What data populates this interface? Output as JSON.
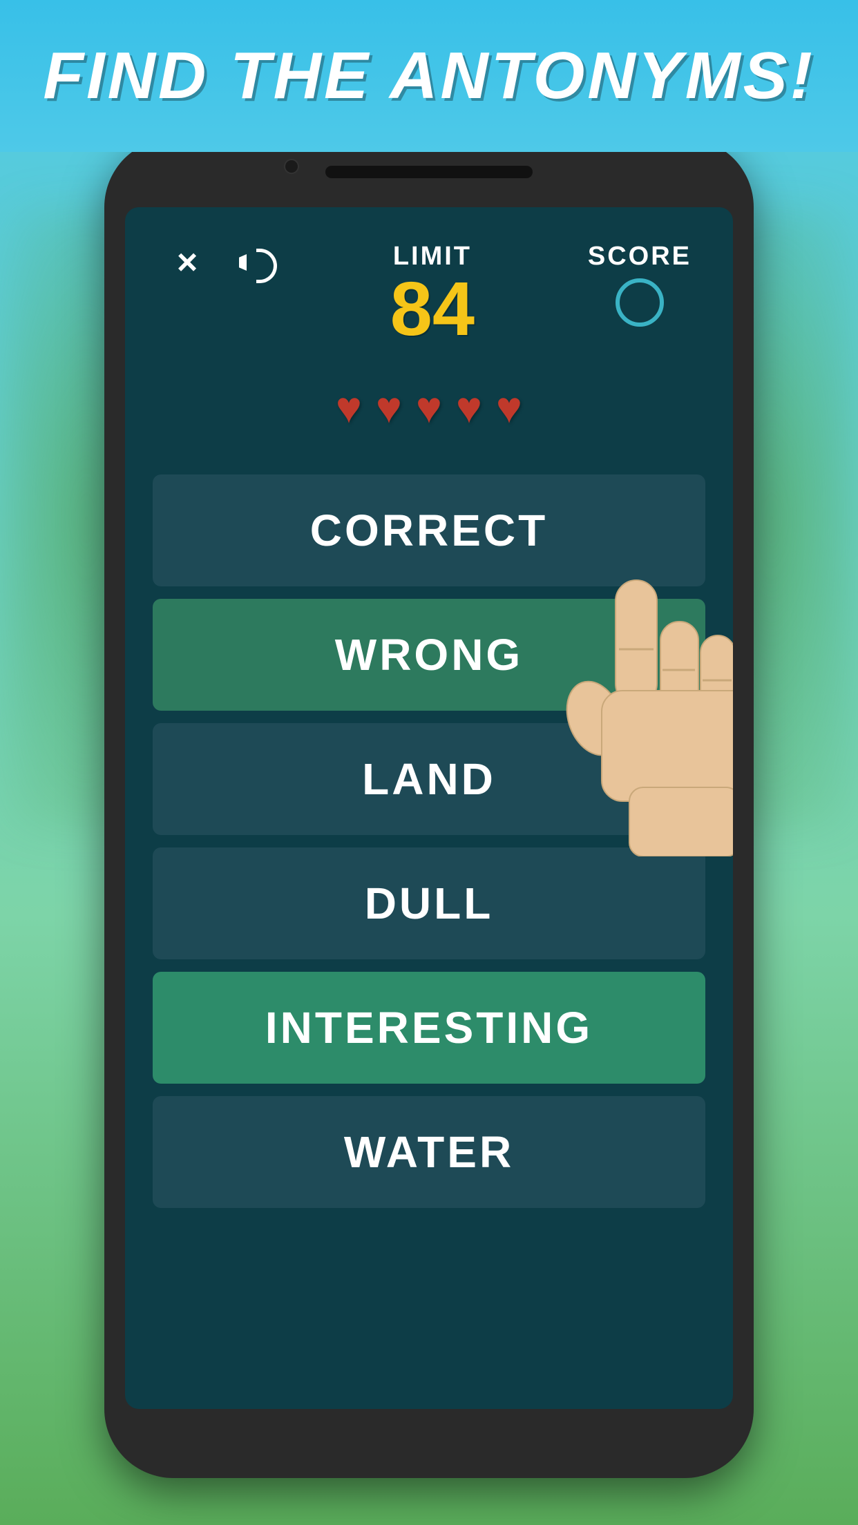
{
  "background": {
    "sky_color_top": "#38c0e8",
    "sky_color_bottom": "#4ec9e8",
    "grass_color": "#5aad5a"
  },
  "title": {
    "text": "FIND THE ANTONYMS!"
  },
  "header": {
    "close_label": "×",
    "sound_label": "sound",
    "limit_label": "LIMIT",
    "limit_value": "84",
    "score_label": "SCORE"
  },
  "lives": {
    "count": 5,
    "heart_symbol": "♥"
  },
  "answers": [
    {
      "label": "CORRECT",
      "style": "dark"
    },
    {
      "label": "WRONG",
      "style": "green"
    },
    {
      "label": "LAND",
      "style": "dark"
    },
    {
      "label": "DULL",
      "style": "dark"
    },
    {
      "label": "INTERESTING",
      "style": "green-bright"
    },
    {
      "label": "WATER",
      "style": "dark"
    }
  ]
}
